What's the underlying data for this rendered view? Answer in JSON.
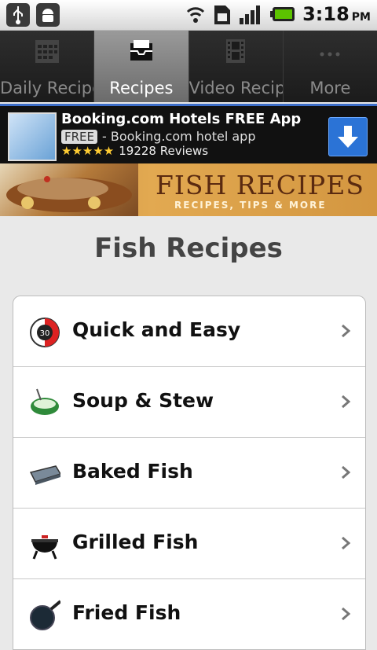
{
  "status_bar": {
    "time": "3:18",
    "ampm": "PM",
    "left_icons": [
      "usb-icon",
      "android-debug-icon"
    ],
    "right_icons": [
      "wifi-icon",
      "sim-icon",
      "signal-icon",
      "battery-icon"
    ]
  },
  "tabs": [
    {
      "label": "Daily Recipes",
      "icon": "calendar-icon",
      "active": false
    },
    {
      "label": "Recipes",
      "icon": "inbox-icon",
      "active": true
    },
    {
      "label": "Video Recipe",
      "icon": "film-icon",
      "active": false
    },
    {
      "label": "More",
      "icon": "more-icon",
      "active": false
    }
  ],
  "ad": {
    "title": "Booking.com Hotels FREE App",
    "free_badge": "FREE",
    "subtitle": "- Booking.com hotel app",
    "stars": "★★★★★",
    "reviews": "19228 Reviews"
  },
  "banner": {
    "title": "FISH RECIPES",
    "subtitle": "RECIPES, TIPS & MORE"
  },
  "page_title": "Fish Recipes",
  "categories": [
    {
      "label": "Quick and Easy",
      "icon": "timer-30-icon"
    },
    {
      "label": "Soup & Stew",
      "icon": "soup-bowl-icon"
    },
    {
      "label": "Baked Fish",
      "icon": "baking-pan-icon"
    },
    {
      "label": "Grilled Fish",
      "icon": "grill-icon"
    },
    {
      "label": "Fried Fish",
      "icon": "frying-pan-icon"
    }
  ],
  "colors": {
    "accent_blue": "#2b73d6",
    "ad_border": "#3d6ec9"
  }
}
